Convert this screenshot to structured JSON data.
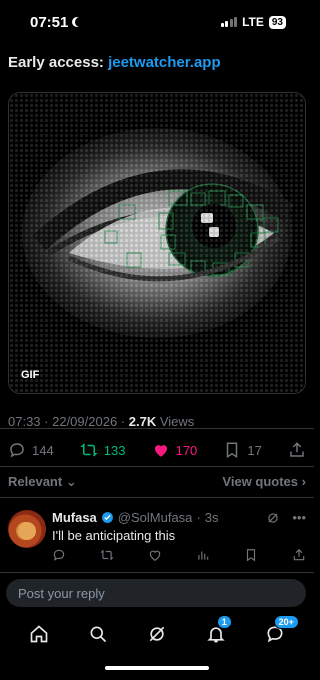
{
  "status_bar": {
    "time": "07:51",
    "network": "LTE",
    "battery": "93"
  },
  "tweet": {
    "text_prefix": "Early access: ",
    "link": "jeetwatcher.app",
    "media_badge": "GIF",
    "time": "07:33",
    "date": "22/09/2026",
    "views_count": "2.7K",
    "views_label": "Views",
    "replies": "144",
    "retweets": "133",
    "likes": "170",
    "bookmarks": "17"
  },
  "sort": {
    "label": "Relevant",
    "quotes": "View quotes"
  },
  "reply": {
    "name": "Mufasa",
    "handle": "@SolMufasa",
    "age": "3s",
    "text": "I'll be anticipating this"
  },
  "composer": {
    "placeholder": "Post your reply"
  },
  "tabbar": {
    "notifications_badge": "1",
    "messages_badge": "20+"
  },
  "colors": {
    "accent": "#1d9bf0",
    "retweet": "#00ba7c",
    "like": "#f91880",
    "muted": "#71767b"
  }
}
